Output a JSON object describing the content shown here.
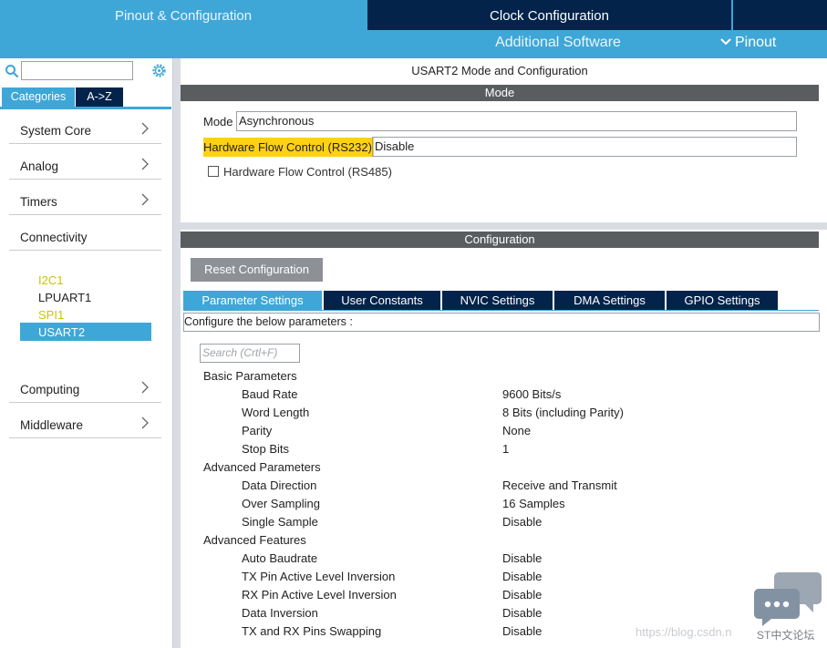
{
  "top_tabs": {
    "pinout_config": "Pinout & Configuration",
    "clock_config": "Clock Configuration",
    "additional_software": "Additional Software",
    "pinout": "Pinout"
  },
  "left": {
    "search_value": "",
    "categories_tab": "Categories",
    "az_tab": "A->Z",
    "categories": [
      {
        "label": "System Core"
      },
      {
        "label": "Analog"
      },
      {
        "label": "Timers"
      },
      {
        "label": "Connectivity"
      },
      {
        "label": "Computing"
      },
      {
        "label": "Middleware"
      }
    ],
    "peripherals": [
      {
        "label": "I2C1",
        "state": "warning"
      },
      {
        "label": "LPUART1",
        "state": "normal"
      },
      {
        "label": "SPI1",
        "state": "warning"
      },
      {
        "label": "USART2",
        "state": "selected"
      }
    ]
  },
  "mode": {
    "title": "USART2 Mode and Configuration",
    "section": "Mode",
    "mode_label": "Mode",
    "mode_value": "Asynchronous",
    "hwfc_label": "Hardware Flow Control (RS232)",
    "hwfc_value": "Disable",
    "rs485_label": "Hardware Flow Control (RS485)",
    "rs485_checked": false
  },
  "config": {
    "section": "Configuration",
    "reset_button": "Reset Configuration",
    "tabs": [
      "Parameter Settings",
      "User Constants",
      "NVIC Settings",
      "DMA Settings",
      "GPIO Settings"
    ],
    "configure_text": "Configure the below parameters :",
    "search_placeholder": "Search (Crtl+F)",
    "groups": [
      {
        "name": "Basic Parameters",
        "params": [
          {
            "name": "Baud Rate",
            "value": "9600 Bits/s"
          },
          {
            "name": "Word Length",
            "value": "8 Bits (including Parity)"
          },
          {
            "name": "Parity",
            "value": "None"
          },
          {
            "name": "Stop Bits",
            "value": "1"
          }
        ]
      },
      {
        "name": "Advanced Parameters",
        "params": [
          {
            "name": "Data Direction",
            "value": "Receive and Transmit"
          },
          {
            "name": "Over Sampling",
            "value": "16 Samples"
          },
          {
            "name": "Single Sample",
            "value": "Disable"
          }
        ]
      },
      {
        "name": "Advanced Features",
        "params": [
          {
            "name": "Auto Baudrate",
            "value": "Disable"
          },
          {
            "name": "TX Pin Active Level Inversion",
            "value": "Disable"
          },
          {
            "name": "RX Pin Active Level Inversion",
            "value": "Disable"
          },
          {
            "name": "Data Inversion",
            "value": "Disable"
          },
          {
            "name": "TX and RX Pins Swapping",
            "value": "Disable"
          }
        ]
      }
    ]
  },
  "watermark": {
    "url": "https://blog.csdn.n",
    "brand": "ST中文论坛"
  },
  "colors": {
    "accent": "#3ea7d8",
    "navy": "#03234b",
    "bar": "#5a5d60",
    "warning": "#c9c400",
    "highlight": "#ffd116"
  }
}
